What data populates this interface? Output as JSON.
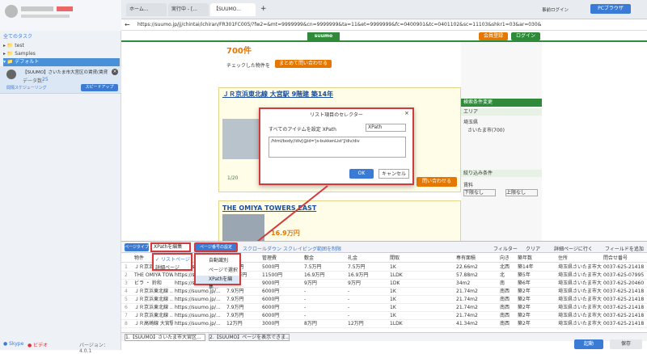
{
  "sidebar": {
    "tasks_title": "全てのタスク",
    "tree": [
      "test",
      "Samples",
      "デフォルト"
    ],
    "task": {
      "title": "【SUUMO】さいたま市大宮区の賃貸(賃貸",
      "count_label": "データ数:",
      "count": "25",
      "status": "間隔スケジューリング",
      "speed": "スピードアップ"
    },
    "footer": {
      "help": "Skype",
      "manual": "ビデオ",
      "version": "バージョン：4.0.1"
    }
  },
  "browser": {
    "tabs": [
      "ホーム...",
      "実行中 - [...",
      "【SUUMO..."
    ],
    "login": "事前ログイン",
    "pc_browser": "PCブラウザ",
    "url": "https://suumo.jp/jj/chintai/ichiran/FR301FC005/?fw2=&mt=9999999&cn=9999999&ta=11&et=9999999&fc=0400901&tc=0401102&sc=11103&shkr1=03&ar=030&"
  },
  "site": {
    "count": "700件",
    "check_note": "チェックした物件を",
    "bulk_inquiry": "まとめて問い合わせる",
    "listing1": "ＪＲ京浜東北線 大宮駅 9階建 築14年",
    "listing2": "THE OMIYA TOWERS EAST",
    "price": "16.9万円",
    "page_info": "1/20",
    "inquiry": "問い合わせる",
    "right_title": "検索条件変更",
    "area": "エリア",
    "pref": "埼玉県",
    "city": "さいたま市(700)",
    "narrow": "絞り込み条件",
    "rent": "賃料",
    "lower": "下限なし",
    "upper": "上限なし",
    "header_btns": [
      "会員登録",
      "ログイン"
    ]
  },
  "dialog": {
    "title": "リスト項目のセレクター",
    "label": "すべてのアイテムを設定 XPath",
    "mode": "XPath",
    "xpath": "/html/body//div[@id='js-bukkenList']/div/div",
    "ok": "OK",
    "cancel": "キャンセル"
  },
  "bottom": {
    "page_type": "ページタイプ",
    "xpath_edit": "XPathを編集",
    "list_page": "リストページ",
    "detail_page": "詳細ページ",
    "page_num": "ページ番号の設定",
    "auto": "自動識別",
    "page_select": "ページで選択",
    "xpath_edit2": "XPathを編集...",
    "scroll": "スクロールダウン",
    "schedule": "スクレイピング範囲を制限",
    "filter": "フィルター",
    "clear": "クリア",
    "detail_go": "詳細ページに行く",
    "add_field": "フィールドを追加",
    "headers": [
      "物件",
      "",
      "管理費",
      "敷金",
      "礼金",
      "間取",
      "専有面積",
      "向き",
      "築年数",
      "住所",
      "問合せ番号"
    ],
    "rows": [
      [
        "ＪＲ京浜東北...",
        "https://suumo.jp/...",
        "5000円",
        "7.5万円",
        "7.5万円",
        "1K",
        "22.66m2",
        "北西",
        "築14年",
        "埼玉県さいたま市大宮区...",
        "0037-625-21418"
      ],
      [
        "THE OMIYA TOWE...",
        "https://suumo.jp/...",
        "11500円",
        "16.9万円",
        "16.9万円",
        "1LDK",
        "57.88m2",
        "北",
        "築5年",
        "埼玉県さいたま市大宮区...",
        "0037-625-07995"
      ],
      [
        "ビラ ・ 鈴和",
        "https://suumo.jp/...",
        "9000円",
        "9万円",
        "9万円",
        "1DK",
        "34m2",
        "南",
        "築6年",
        "埼玉県さいたま市大宮区...",
        "0037-625-20460"
      ],
      [
        "ＪＲ京浜東北線 ...",
        "https://suumo.jp/...",
        "6000円",
        "-",
        "-",
        "1K",
        "21.74m2",
        "南西",
        "築2年",
        "埼玉県さいたま市大宮区...",
        "0037-625-21418"
      ],
      [
        "ＪＲ京浜東北線 ...",
        "https://suumo.jp/...",
        "6000円",
        "-",
        "-",
        "1K",
        "21.74m2",
        "南西",
        "築2年",
        "埼玉県さいたま市大宮区...",
        "0037-625-21418"
      ],
      [
        "ＪＲ京浜東北線 ...",
        "https://suumo.jp/...",
        "6000円",
        "-",
        "-",
        "1K",
        "21.74m2",
        "南西",
        "築2年",
        "埼玉県さいたま市大宮区...",
        "0037-625-21418"
      ],
      [
        "ＪＲ京浜東北線 ...",
        "https://suumo.jp/...",
        "6000円",
        "-",
        "-",
        "1K",
        "21.74m2",
        "南西",
        "築2年",
        "埼玉県さいたま市大宮区...",
        "0037-625-21418"
      ],
      [
        "ＪＲ高崎線 大宮駅",
        "https://suumo.jp/...",
        "3000円",
        "8万円",
        "12万円",
        "1LDK",
        "41.34m2",
        "南西",
        "築2年",
        "埼玉県さいたま市大宮区...",
        "0037-625-21418"
      ]
    ],
    "prices": [
      "7.5万円",
      "16.9万円",
      "9万円",
      "7.9万円",
      "7.9万円",
      "7.9万円",
      "7.9万円",
      "12万円"
    ],
    "step_tabs": [
      "1.【SUUMO】さいたま市大宮区...",
      "2.【SUUMO】ページを表示できま..."
    ],
    "start": "起動",
    "save": "保存"
  }
}
